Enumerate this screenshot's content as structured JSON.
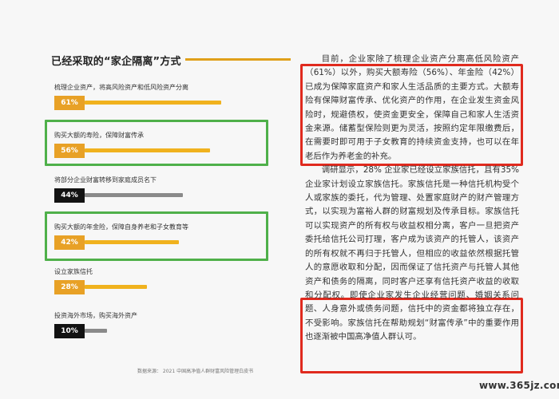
{
  "left_panel": {
    "section_title": "已经采取的“家企隔离”方式",
    "items": [
      {
        "label": "梳理企业资产，将高风险资产和低风险资产分离",
        "percent_label": "61%",
        "value": 0.61
      },
      {
        "label": "购买大额的寿险，保障财富传承",
        "percent_label": "56%",
        "value": 0.56
      },
      {
        "label": "将部分企业财富转移到家庭成员名下",
        "percent_label": "44%",
        "value": 0.44
      },
      {
        "label": "购买大额的年金险，保障自身养老和子女教育等",
        "percent_label": "42%",
        "value": 0.42
      },
      {
        "label": "设立家族信托",
        "percent_label": "28%",
        "value": 0.28
      },
      {
        "label": "投资海外市场，购买海外资产",
        "percent_label": "10%",
        "value": 0.1
      }
    ],
    "source_note": "数据来源： 2021 中国高净值人群财富风险管理白皮书"
  },
  "right_panel": {
    "paragraph_1": "目前，企业家除了梳理企业资产分离高低风险资产（61%）以外，购买大额寿险（56%）、年金险（42%）已成为保障家庭资产和家人生活品质的主要方式。大额寿险有保障财富传承、优化资产的作用，在企业发生资金风险时，规避债权，使资金更安全，保障自己和家人生活资金来源。储蓄型保险则更为灵活，按照约定年限缴费后，在需要时即可用于子女教育的持续资金支持，也可以在年老后作为养老金的补充。",
    "paragraph_2": "调研显示，28% 企业家已经设立家族信托，且有35% 企业家计划设立家族信托。家族信托是一种信托机构受个人或家族的委托，代为管理、处置家庭财产的财产管理方式，以实现为富裕人群的财富规划及传承目标。家族信托可以实现资产的所有权与收益权相分离，客户一旦把资产委托给信托公司打理，客户成为该资产的托管人，该资产的所有权就不再归于托管人，但相应的收益依然根据托管人的意愿收取和分配，因而保证了信托资产与托管人其他资产和债务的隔离，同时客户还享有信托资产收益的收取和分配权。即使企业家发生企业经营问题、婚姻关系问题、人身意外或债务问题，信托中的资金都将独立存在，不受影响。家族信托在帮助规划“财富传承”中的重要作用也逐渐被中国高净值人群认可。"
  },
  "watermark": "www.365jz.com",
  "colors": {
    "gold": "#e8a126",
    "bar_gold": "#f0b21e",
    "dark_box": "#121212",
    "gray_bar": "#8a8a8a",
    "highlight_green": "#4fb04a",
    "highlight_red": "#e02a1e"
  }
}
